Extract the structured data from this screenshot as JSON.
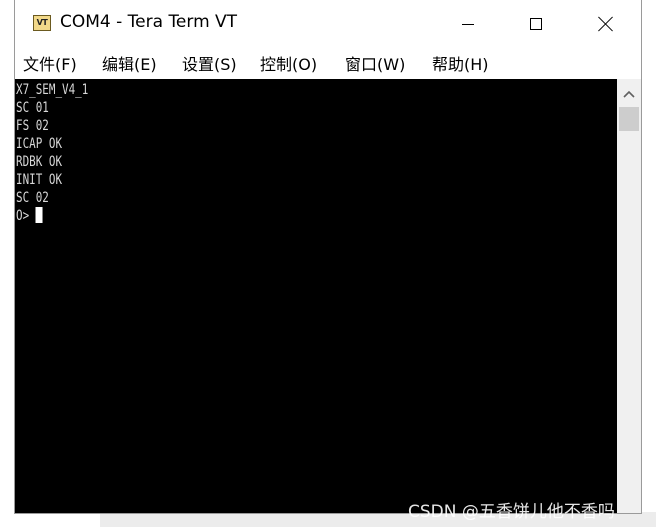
{
  "window": {
    "title": "COM4 - Tera Term VT",
    "icon_label": "VT"
  },
  "menu": {
    "items": [
      {
        "label": "文件(F)"
      },
      {
        "label": "编辑(E)"
      },
      {
        "label": "设置(S)"
      },
      {
        "label": "控制(O)"
      },
      {
        "label": "窗口(W)"
      },
      {
        "label": "帮助(H)"
      }
    ]
  },
  "terminal": {
    "lines": [
      "X7_SEM_V4_1",
      "SC 01",
      "FS 02",
      "ICAP OK",
      "RDBK OK",
      "INIT OK",
      "SC 02"
    ],
    "prompt": "O> "
  },
  "watermark": "CSDN @五香饼儿他不香吗",
  "colors": {
    "terminal_bg": "#000000",
    "terminal_fg": "#d8d8d8",
    "cursor": "#ffffff",
    "scrollbar_track": "#f0f0f0",
    "scrollbar_thumb": "#cdcdcd"
  }
}
